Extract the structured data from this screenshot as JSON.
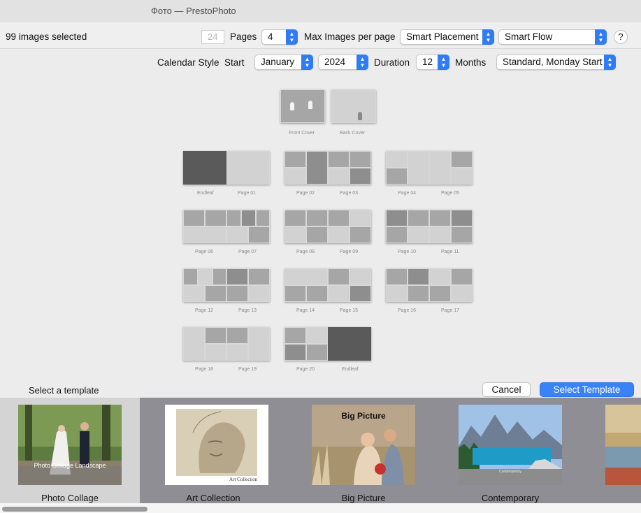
{
  "window": {
    "title": "Фото — PrestoPhoto"
  },
  "toolbar": {
    "selected_count": "99 images selected",
    "pages_value": "24",
    "pages_label": "Pages",
    "max_images_value": "4",
    "max_images_label": "Max Images per page",
    "placement": "Smart Placement",
    "flow": "Smart Flow",
    "help": "?"
  },
  "calendar": {
    "style_label": "Calendar Style",
    "start_label": "Start",
    "start_month": "January",
    "start_year": "2024",
    "duration_label": "Duration",
    "duration_value": "12",
    "months_label": "Months",
    "week_style": "Standard, Monday Start"
  },
  "spreads": {
    "covers": [
      "Front Cover",
      "Back Cover"
    ],
    "rows": [
      [
        [
          "Endleaf",
          "Page 01"
        ],
        [
          "Page 02",
          "Page 03"
        ],
        [
          "Page 04",
          "Page 05"
        ]
      ],
      [
        [
          "Page 06",
          "Page 07"
        ],
        [
          "Page 08",
          "Page 09"
        ],
        [
          "Page 10",
          "Page 11"
        ]
      ],
      [
        [
          "Page 12",
          "Page 13"
        ],
        [
          "Page 14",
          "Page 15"
        ],
        [
          "Page 16",
          "Page 17"
        ]
      ],
      [
        [
          "Page 18",
          "Page 19"
        ],
        [
          "Page 20",
          "Endleaf"
        ]
      ]
    ]
  },
  "footer": {
    "select_template_label": "Select a template",
    "cancel": "Cancel",
    "select": "Select Template"
  },
  "templates": [
    {
      "name": "Photo Collage",
      "cover_text": "Photo Collage Landscape",
      "selected": true
    },
    {
      "name": "Art Collection",
      "cover_text": "Art Collection",
      "selected": false
    },
    {
      "name": "Big Picture",
      "cover_text": "Big Picture",
      "selected": false
    },
    {
      "name": "Contemporary",
      "cover_text": "Contemporary",
      "selected": false
    }
  ],
  "colors": {
    "accent": "#3a82f7",
    "strip": "#8e8e94",
    "selected_tile": "#d4d4d4"
  }
}
